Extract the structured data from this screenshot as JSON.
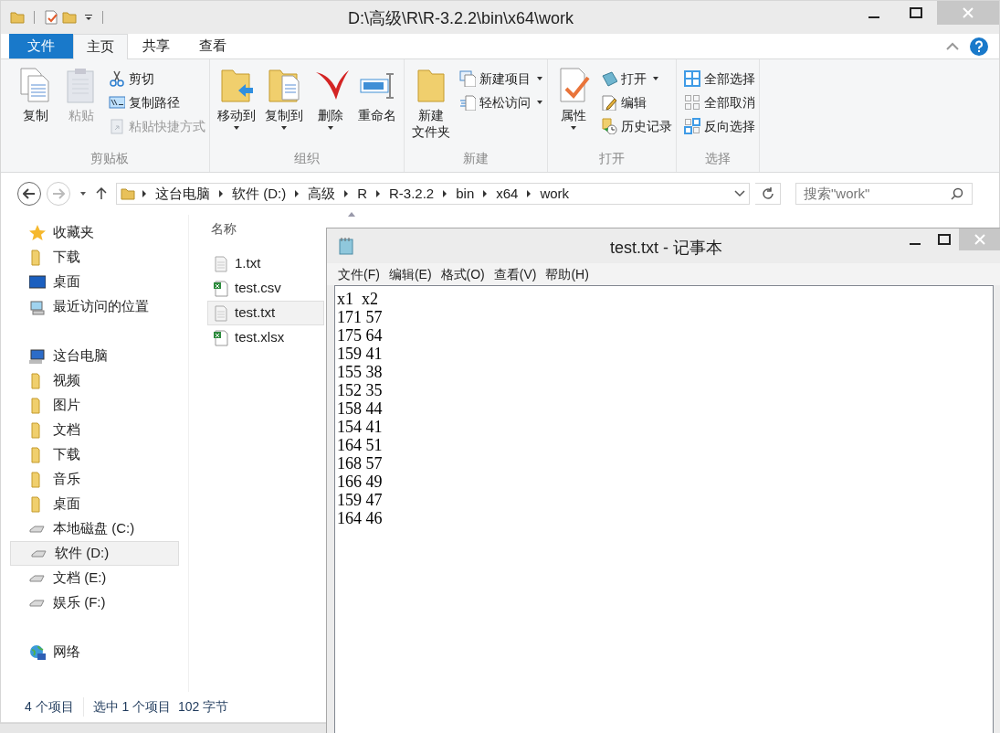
{
  "explorer": {
    "title": "D:\\高级\\R\\R-3.2.2\\bin\\x64\\work",
    "tabs": [
      {
        "label": "文件",
        "kind": "file",
        "selected": false
      },
      {
        "label": "主页",
        "kind": "tab",
        "selected": true
      },
      {
        "label": "共享",
        "kind": "tab",
        "selected": false
      },
      {
        "label": "查看",
        "kind": "tab",
        "selected": false
      }
    ],
    "ribbon": [
      {
        "label": "剪贴板",
        "items": [
          {
            "label": "复制",
            "kind": "large",
            "disabled": false,
            "dropdown": false
          },
          {
            "label": "粘贴",
            "kind": "large",
            "disabled": true,
            "dropdown": false
          },
          {
            "label": "剪切",
            "kind": "small",
            "disabled": false,
            "dropdown": false
          },
          {
            "label": "复制路径",
            "kind": "small",
            "disabled": false,
            "dropdown": false
          },
          {
            "label": "粘贴快捷方式",
            "kind": "small",
            "disabled": true,
            "dropdown": false
          }
        ]
      },
      {
        "label": "组织",
        "items": [
          {
            "label": "移动到",
            "kind": "large",
            "disabled": false,
            "dropdown": true
          },
          {
            "label": "复制到",
            "kind": "large",
            "disabled": false,
            "dropdown": true
          },
          {
            "label": "删除",
            "kind": "large",
            "disabled": false,
            "dropdown": true
          },
          {
            "label": "重命名",
            "kind": "large",
            "disabled": false,
            "dropdown": false
          }
        ]
      },
      {
        "label": "新建",
        "items": [
          {
            "label": [
              "新建",
              "文件夹"
            ],
            "kind": "large",
            "disabled": false,
            "dropdown": false
          },
          {
            "label": "新建项目",
            "kind": "small",
            "disabled": false,
            "dropdown": true
          },
          {
            "label": "轻松访问",
            "kind": "small",
            "disabled": false,
            "dropdown": true
          }
        ]
      },
      {
        "label": "打开",
        "items": [
          {
            "label": "属性",
            "kind": "large",
            "disabled": false,
            "dropdown": true
          },
          {
            "label": "打开",
            "kind": "small",
            "disabled": false,
            "dropdown": true
          },
          {
            "label": "编辑",
            "kind": "small",
            "disabled": false,
            "dropdown": false
          },
          {
            "label": "历史记录",
            "kind": "small",
            "disabled": false,
            "dropdown": false
          }
        ]
      },
      {
        "label": "选择",
        "items": [
          {
            "label": "全部选择",
            "kind": "small",
            "disabled": false,
            "dropdown": false
          },
          {
            "label": "全部取消",
            "kind": "small",
            "disabled": false,
            "dropdown": false
          },
          {
            "label": "反向选择",
            "kind": "small",
            "disabled": false,
            "dropdown": false
          }
        ]
      }
    ],
    "breadcrumbs": [
      "这台电脑",
      "软件 (D:)",
      "高级",
      "R",
      "R-3.2.2",
      "bin",
      "x64",
      "work"
    ],
    "search": {
      "placeholder": "搜索\"work\""
    },
    "nav": [
      {
        "label": "收藏夹",
        "kind": "favorites",
        "selected": false,
        "children": [
          {
            "label": "下载",
            "kind": "folder",
            "selected": false
          },
          {
            "label": "桌面",
            "kind": "desktop",
            "selected": false
          },
          {
            "label": "最近访问的位置",
            "kind": "recent",
            "selected": false
          }
        ]
      },
      {
        "label": "这台电脑",
        "kind": "computer",
        "selected": false,
        "children": [
          {
            "label": "视频",
            "kind": "folder",
            "selected": false
          },
          {
            "label": "图片",
            "kind": "folder",
            "selected": false
          },
          {
            "label": "文档",
            "kind": "folder",
            "selected": false
          },
          {
            "label": "下载",
            "kind": "folder",
            "selected": false
          },
          {
            "label": "音乐",
            "kind": "folder",
            "selected": false
          },
          {
            "label": "桌面",
            "kind": "folder",
            "selected": false
          },
          {
            "label": "本地磁盘 (C:)",
            "kind": "drive",
            "selected": false
          },
          {
            "label": "软件 (D:)",
            "kind": "drive",
            "selected": true
          },
          {
            "label": "文档 (E:)",
            "kind": "drive",
            "selected": false
          },
          {
            "label": "娱乐 (F:)",
            "kind": "drive",
            "selected": false
          }
        ]
      },
      {
        "label": "网络",
        "kind": "network",
        "selected": false
      }
    ],
    "columns": [
      "名称"
    ],
    "files": [
      {
        "name": "1.txt",
        "kind": "text",
        "selected": false
      },
      {
        "name": "test.csv",
        "kind": "sheet",
        "selected": false
      },
      {
        "name": "test.txt",
        "kind": "text",
        "selected": true
      },
      {
        "name": "test.xlsx",
        "kind": "sheet",
        "selected": false
      }
    ],
    "status_bar": [
      "4 个项目",
      "选中 1 个项目  102 字节"
    ]
  },
  "notepad": {
    "title": "test.txt - 记事本",
    "menu": [
      "文件(F)",
      "编辑(E)",
      "格式(O)",
      "查看(V)",
      "帮助(H)"
    ],
    "lines": [
      "x1  x2",
      "171 57",
      "175 64",
      "159 41",
      "155 38",
      "152 35",
      "158 44",
      "154 41",
      "164 51",
      "168 57",
      "166 49",
      "159 47",
      "164 46"
    ]
  }
}
